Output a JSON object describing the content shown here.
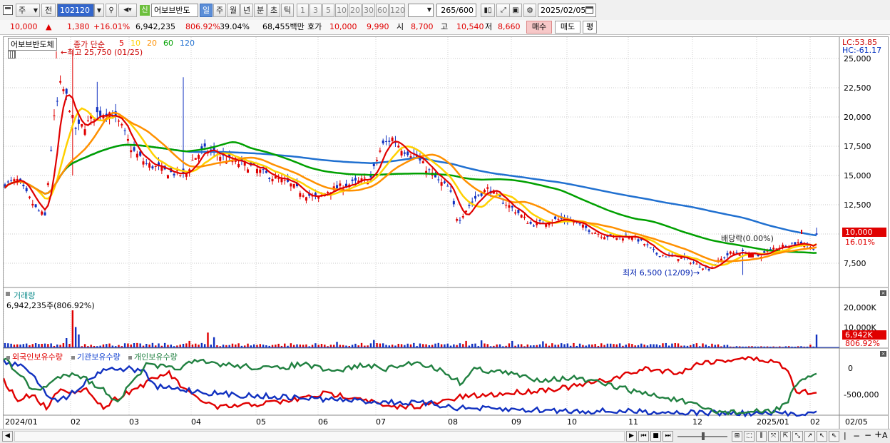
{
  "toolbar": {
    "mode_label": "주",
    "prev_label": "전",
    "code_value": "102120",
    "name_value": "어보브반도",
    "period_tabs": [
      "일",
      "주",
      "월",
      "년",
      "분",
      "초",
      "틱"
    ],
    "active_period": "일",
    "num_tabs": [
      "1",
      "3",
      "5",
      "10",
      "20",
      "30",
      "60",
      "120"
    ],
    "count_value": "265",
    "count_total": "/600",
    "date_value": "2025/02/05",
    "new_badge": "신"
  },
  "quote": {
    "price": "10,000",
    "up_arrow": "▲",
    "change": "1,380",
    "change_pct": "+16.01%",
    "volume": "6,942,235",
    "volume_ratio": "806.92%",
    "turnover_pct": "39.04%",
    "amount": "68,455백만",
    "ask_label": "호가",
    "ask1": "10,000",
    "bid1": "9,990",
    "open_label": "시",
    "open": "8,700",
    "high_label": "고",
    "high": "10,540",
    "low_label": "저",
    "low": "8,660",
    "buy_label": "매수",
    "sell_label": "매도",
    "avg_label": "평"
  },
  "price_panel": {
    "stock_label": "어보브반도체",
    "legend_prefix": "종가 단순",
    "ma_legend": [
      {
        "label": "5",
        "color": "#e00000"
      },
      {
        "label": "10",
        "color": "#ffd000"
      },
      {
        "label": "20",
        "color": "#ff9000"
      },
      {
        "label": "60",
        "color": "#00a000"
      },
      {
        "label": "120",
        "color": "#2070d0"
      }
    ],
    "lc": "LC:53.85",
    "hc": "HC:-61.17",
    "high_annot": "최고 25,750 (01/25)",
    "low_annot": "최저 6,500 (12/09)",
    "dividend_annot": "배당락(0.00%)",
    "price_tag": "10,000",
    "pct_tag": "16.01%",
    "y_labels": [
      "25,000",
      "22,500",
      "20,000",
      "17,500",
      "15,000",
      "12,500",
      "10,000",
      "7,500"
    ]
  },
  "volume_panel": {
    "title": "거래량",
    "value": "6,942,235주(806.92%)",
    "y_label": "20,000K",
    "y_label2": "10,000K",
    "tag": "6,942K",
    "tag2": "806.92%"
  },
  "investor_panel": {
    "legend": [
      "외국인보유수량",
      "기관보유수량",
      "개인보유수량"
    ],
    "y_labels": [
      "0",
      "-500,000"
    ]
  },
  "x_labels": [
    "2024/01",
    "02",
    "03",
    "04",
    "05",
    "06",
    "07",
    "08",
    "09",
    "10",
    "11",
    "12",
    "2025/01",
    "02",
    "02/05"
  ],
  "colors": {
    "up": "#e00000",
    "down": "#1030c0",
    "ma5": "#e00000",
    "ma10": "#ffd000",
    "ma20": "#ff9000",
    "ma60": "#00a000",
    "ma120": "#2070d0"
  }
}
